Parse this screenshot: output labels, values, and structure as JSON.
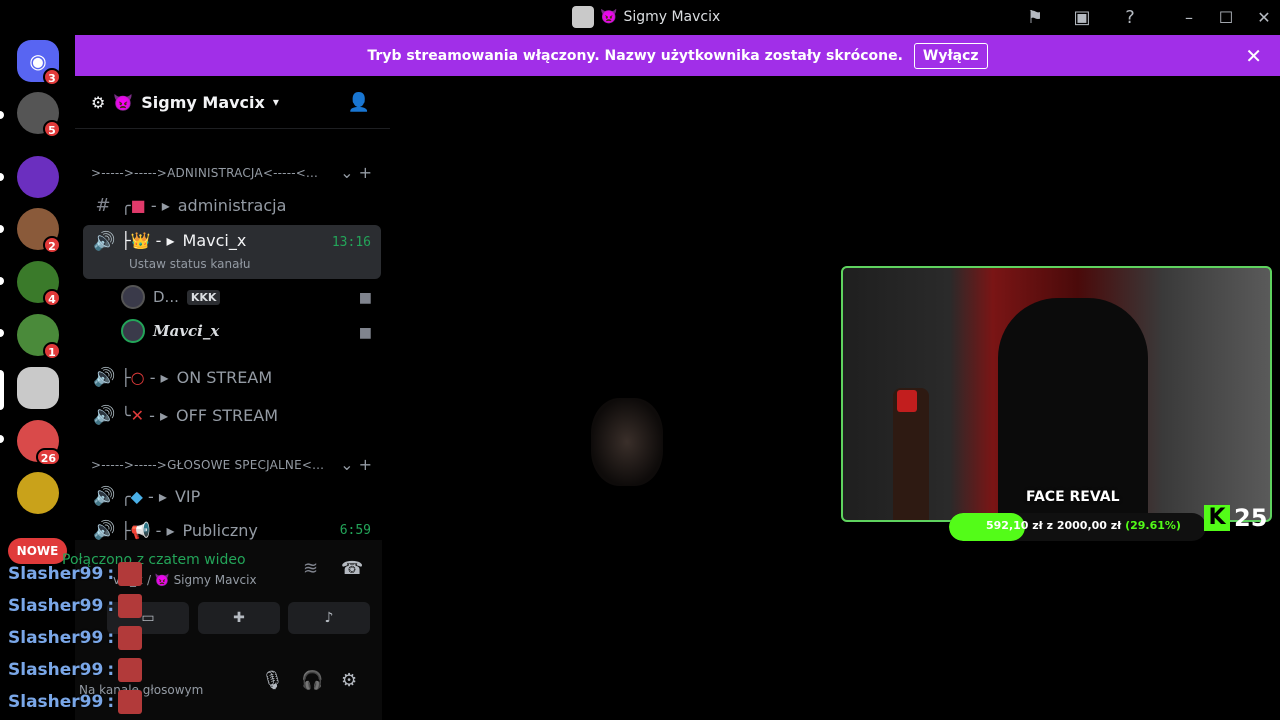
{
  "titlebar": {
    "title": "Sigmy Mavcix",
    "server_emoji": "👿"
  },
  "banner": {
    "text": "Tryb streamowania włączony. Nazwy użytkownika zostały skrócone.",
    "button": "Wyłącz"
  },
  "servers": {
    "items": [
      {
        "name": "discord-home",
        "badge": "3",
        "color": "#5865f2"
      },
      {
        "name": "server-2",
        "badge": "5",
        "color": "#555"
      },
      {
        "name": "server-zakon",
        "badge": "",
        "color": "#6b2fbf"
      },
      {
        "name": "server-4",
        "badge": "2",
        "color": "#8a5a3a"
      },
      {
        "name": "server-5",
        "badge": "4",
        "color": "#3a7a2a"
      },
      {
        "name": "server-6",
        "badge": "1",
        "color": "#4a8a3a"
      },
      {
        "name": "server-7",
        "badge": "",
        "color": "#c9c9c9"
      },
      {
        "name": "server-8",
        "badge": "26",
        "color": "#d94a4a"
      },
      {
        "name": "server-9",
        "badge": "",
        "color": "#c9a21a"
      }
    ],
    "new_label": "NOWE"
  },
  "sidebar": {
    "server_name": "Sigmy Mavcix",
    "cat1": ">----->----->ADNINISTRACJA<-----<...",
    "ch_admin": "administracja",
    "ch_mavci": "Mavci_x",
    "ch_mavci_time": "13:16",
    "ch_mavci_status": "Ustaw status kanału",
    "user1": "D...",
    "user1_tag": "KKK",
    "user2": "Mavci_x",
    "ch_on": "ON STREAM",
    "ch_off": "OFF STREAM",
    "cat2": ">----->----->GŁOSOWE SPECJALNE<...",
    "ch_vip": "VIP",
    "ch_pub": "Publiczny",
    "ch_pub_time": "6:59"
  },
  "panel": {
    "connected": "Połączono z czatem wideo",
    "location": "vci_x / 👿 Sigmy Mavcix",
    "user_status": "Na kanale głosowym"
  },
  "stream": {
    "face_text": "FACE REVAL",
    "progress_text": "592,10 zł  z  2000,00 zł",
    "progress_pct": "(29.61%)",
    "progress_value": 0.2961,
    "kick_count": "25"
  },
  "chat": [
    {
      "user": "Slasher99",
      "sep": ":"
    },
    {
      "user": "Slasher99",
      "sep": ":"
    },
    {
      "user": "Slasher99",
      "sep": ":"
    },
    {
      "user": "Slasher99",
      "sep": ":"
    },
    {
      "user": "Slasher99",
      "sep": ":"
    }
  ]
}
